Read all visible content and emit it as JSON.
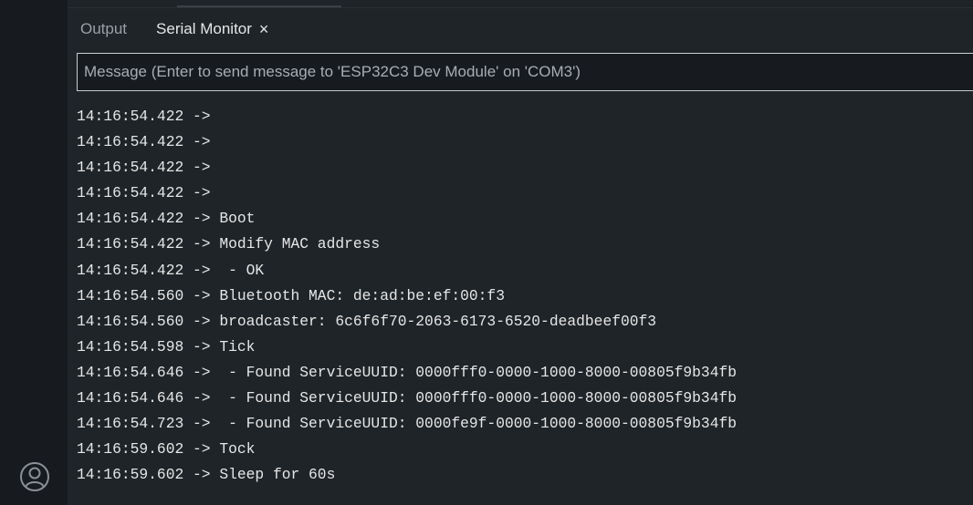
{
  "panel": {
    "tabs": [
      {
        "label": "Output",
        "active": false
      },
      {
        "label": "Serial Monitor",
        "active": true,
        "close_glyph": "×"
      }
    ],
    "message_input": {
      "value": "",
      "placeholder": "Message (Enter to send message to 'ESP32C3 Dev Module' on 'COM3')"
    }
  },
  "icons": {
    "account": "account-icon",
    "close": "close-icon"
  },
  "colors": {
    "background": "#1f2428",
    "activity_bar": "#171b20",
    "text": "#e6e6e6",
    "muted_text": "#9aa0a6",
    "input_border": "#c8ccd0"
  },
  "log_lines": [
    "14:16:54.422 ->",
    "14:16:54.422 ->",
    "14:16:54.422 ->",
    "14:16:54.422 ->",
    "14:16:54.422 -> Boot",
    "14:16:54.422 -> Modify MAC address",
    "14:16:54.422 ->  - OK",
    "14:16:54.560 -> Bluetooth MAC: de:ad:be:ef:00:f3",
    "14:16:54.560 -> broadcaster: 6c6f6f70-2063-6173-6520-deadbeef00f3",
    "14:16:54.598 -> Tick",
    "14:16:54.646 ->  - Found ServiceUUID: 0000fff0-0000-1000-8000-00805f9b34fb",
    "14:16:54.646 ->  - Found ServiceUUID: 0000fff0-0000-1000-8000-00805f9b34fb",
    "14:16:54.723 ->  - Found ServiceUUID: 0000fe9f-0000-1000-8000-00805f9b34fb",
    "14:16:59.602 -> Tock",
    "14:16:59.602 -> Sleep for 60s"
  ]
}
